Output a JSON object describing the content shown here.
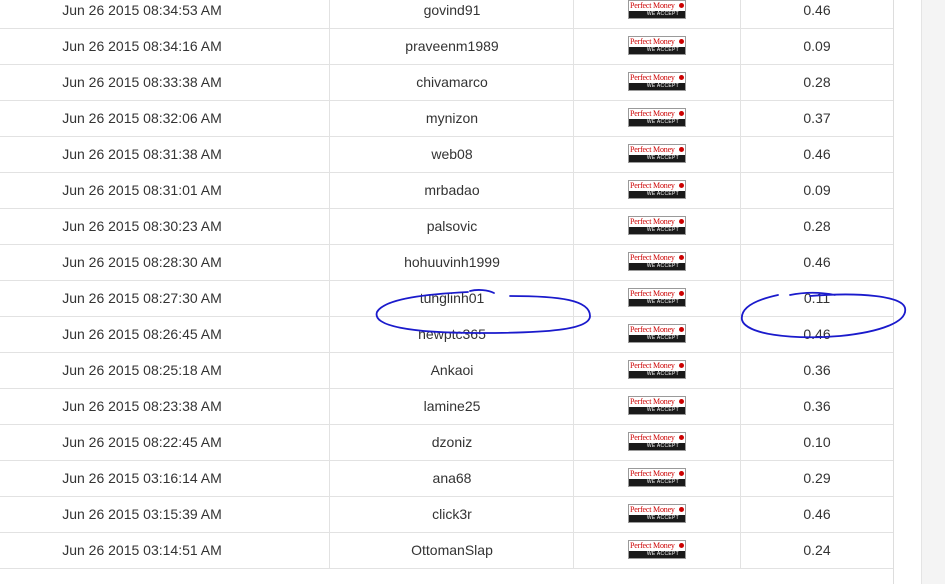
{
  "payment_logo": {
    "brand": "Perfect Money",
    "tag": "WE ACCEPT",
    "icon": "perfect-money-logo-icon"
  },
  "rows": [
    {
      "date": "Jun 26 2015 08:34:53 AM",
      "user": "govind91",
      "amount": "0.46"
    },
    {
      "date": "Jun 26 2015 08:34:16 AM",
      "user": "praveenm1989",
      "amount": "0.09"
    },
    {
      "date": "Jun 26 2015 08:33:38 AM",
      "user": "chivamarco",
      "amount": "0.28"
    },
    {
      "date": "Jun 26 2015 08:32:06 AM",
      "user": "mynizon",
      "amount": "0.37"
    },
    {
      "date": "Jun 26 2015 08:31:38 AM",
      "user": "web08",
      "amount": "0.46"
    },
    {
      "date": "Jun 26 2015 08:31:01 AM",
      "user": "mrbadao",
      "amount": "0.09"
    },
    {
      "date": "Jun 26 2015 08:30:23 AM",
      "user": "palsovic",
      "amount": "0.28"
    },
    {
      "date": "Jun 26 2015 08:28:30 AM",
      "user": "hohuuvinh1999",
      "amount": "0.46"
    },
    {
      "date": "Jun 26 2015 08:27:30 AM",
      "user": "tunglinh01",
      "amount": "0.11"
    },
    {
      "date": "Jun 26 2015 08:26:45 AM",
      "user": "newptc365",
      "amount": "0.46"
    },
    {
      "date": "Jun 26 2015 08:25:18 AM",
      "user": "Ankaoi",
      "amount": "0.36"
    },
    {
      "date": "Jun 26 2015 08:23:38 AM",
      "user": "lamine25",
      "amount": "0.36"
    },
    {
      "date": "Jun 26 2015 08:22:45 AM",
      "user": "dzoniz",
      "amount": "0.10"
    },
    {
      "date": "Jun 26 2015 03:16:14 AM",
      "user": "ana68",
      "amount": "0.29"
    },
    {
      "date": "Jun 26 2015 03:15:39 AM",
      "user": "click3r",
      "amount": "0.46"
    },
    {
      "date": "Jun 26 2015 03:14:51 AM",
      "user": "OttomanSlap",
      "amount": "0.24"
    }
  ],
  "colors": {
    "annotation": "#1a1acc",
    "logo_red": "#cc0000",
    "row_border": "#e2e2e2"
  }
}
